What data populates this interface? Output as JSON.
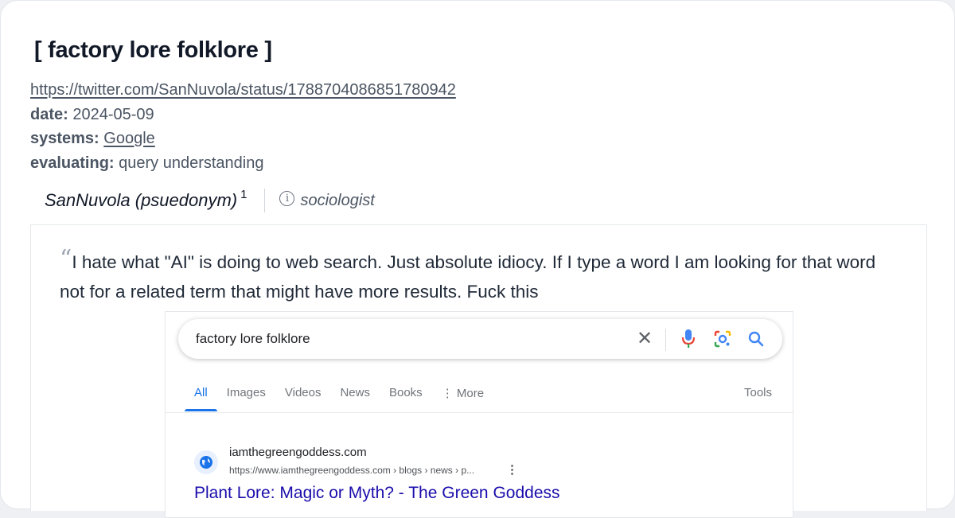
{
  "title": "[ factory lore folklore ]",
  "meta": {
    "url": "https://twitter.com/SanNuvola/status/1788704086851780942",
    "date_label": "date:",
    "date_value": "2024-05-09",
    "systems_label": "systems:",
    "systems_value": "Google",
    "evaluating_label": "evaluating:",
    "evaluating_value": "query understanding"
  },
  "author": {
    "name": "SanNuvola (psuedonym)",
    "footnote": "1",
    "role": "sociologist",
    "info_icon": "info-icon"
  },
  "quote": {
    "mark": "“",
    "text": "I hate what \"AI\" is doing to web search. Just absolute idiocy. If I type a word I am looking for that word not for a related term that might have more results. Fuck this"
  },
  "screenshot": {
    "search_query": "factory lore folklore",
    "icons": [
      "close-icon",
      "microphone-icon",
      "lens-icon",
      "search-icon"
    ],
    "tabs": [
      "All",
      "Images",
      "Videos",
      "News",
      "Books",
      "⋮ More"
    ],
    "active_tab": "All",
    "tools_label": "Tools",
    "result": {
      "site": "iamthegreengoddess.com",
      "url": "https://www.iamthegreengoddess.com › blogs › news › p...",
      "more": "⋮",
      "title": "Plant Lore: Magic or Myth? - The Green Goddess"
    }
  },
  "colors": {
    "accent_blue": "#1a73e8",
    "link_title": "#1a0dab",
    "text_gray": "#4b5563"
  }
}
